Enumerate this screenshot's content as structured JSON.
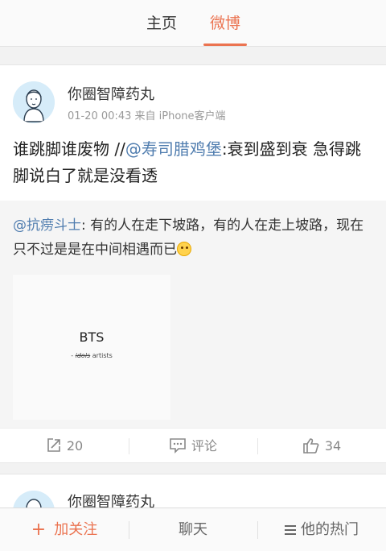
{
  "tabs": {
    "home": "主页",
    "weibo": "微博"
  },
  "colors": {
    "accent": "#eb7350",
    "mention": "#507daf"
  },
  "post": {
    "author": "你圈智障药丸",
    "time": "01-20 00:43",
    "source": "来自 iPhone客户端",
    "text_prefix": "谁跳脚谁废物 //",
    "mention": "@寿司腊鸡堡",
    "text_suffix": ":衰到盛到衰 急得跳脚说白了就是没看透",
    "repost": {
      "mention": "@抗痨斗士",
      "text": ": 有的人在走下坡路，有的人在走上坡路，现在只不过是是在中间相遇而已",
      "image": {
        "title": "BTS",
        "strike": "idols",
        "sub_prefix": "- ",
        "sub_suffix": " artists"
      }
    },
    "actions": {
      "repost_count": "20",
      "comment_label": "评论",
      "like_count": "34"
    }
  },
  "next_post": {
    "author": "你圈智障药丸"
  },
  "bottom": {
    "follow": "加关注",
    "chat": "聊天",
    "hot": "他的热门"
  },
  "icons": [
    "avatar-face-icon",
    "repost-icon",
    "comment-icon",
    "like-icon",
    "plus-icon",
    "menu-icon",
    "smile-emoji-icon"
  ]
}
